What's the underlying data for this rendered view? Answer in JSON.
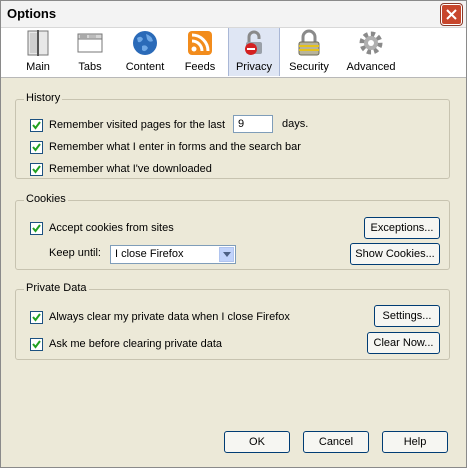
{
  "window": {
    "title": "Options"
  },
  "toolbar": {
    "tabs": [
      {
        "label": "Main",
        "icon": "main-icon"
      },
      {
        "label": "Tabs",
        "icon": "tabs-icon"
      },
      {
        "label": "Content",
        "icon": "globe-icon"
      },
      {
        "label": "Feeds",
        "icon": "rss-icon"
      },
      {
        "label": "Privacy",
        "icon": "lock-icon",
        "selected": true
      },
      {
        "label": "Security",
        "icon": "padlock-icon"
      },
      {
        "label": "Advanced",
        "icon": "gear-icon"
      }
    ]
  },
  "history": {
    "legend": "History",
    "remember_visited_label": "Remember visited pages for the last",
    "days_value": "9",
    "days_unit": "days.",
    "remember_forms_label": "Remember what I enter in forms and the search bar",
    "remember_downloads_label": "Remember what I've downloaded"
  },
  "cookies": {
    "legend": "Cookies",
    "accept_label": "Accept cookies from sites",
    "exceptions_label": "Exceptions...",
    "keep_until_label": "Keep until:",
    "keep_until_value": "I close Firefox",
    "show_cookies_label": "Show Cookies..."
  },
  "private_data": {
    "legend": "Private Data",
    "always_clear_label": "Always clear my private data when I close Firefox",
    "settings_label": "Settings...",
    "ask_before_label": "Ask me before clearing private data",
    "clear_now_label": "Clear Now..."
  },
  "footer": {
    "ok_label": "OK",
    "cancel_label": "Cancel",
    "help_label": "Help"
  },
  "colors": {
    "checkmark": "#21a121",
    "selected_tab": "#dfe6f4",
    "close_button": "#c8462c"
  }
}
